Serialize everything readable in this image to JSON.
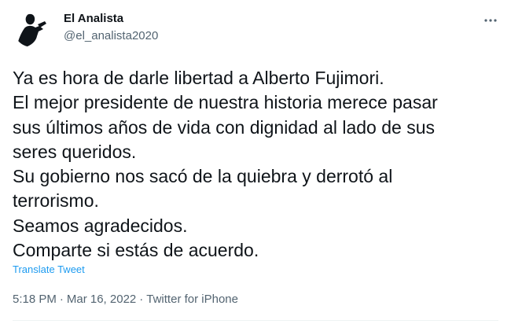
{
  "author": {
    "display_name": "El Analista",
    "handle": "@el_analista2020"
  },
  "icons": {
    "avatar": "silhouette-reading-avatar",
    "more": "more-horizontal-icon"
  },
  "tweet": {
    "lines": [
      "Ya es hora de darle libertad a Alberto Fujimori.",
      "El mejor presidente de nuestra historia merece pasar",
      "sus últimos años de vida con dignidad al lado de sus",
      "seres queridos.",
      "Su gobierno nos sacó de la quiebra y derrotó al",
      "terrorismo.",
      "Seamos agradecidos.",
      "Comparte si estás de acuerdo."
    ],
    "translate_label": "Translate Tweet"
  },
  "meta": {
    "time": "5:18 PM",
    "separator": "·",
    "date": "Mar 16, 2022",
    "source": "Twitter for iPhone"
  },
  "colors": {
    "text": "#0f1419",
    "secondary": "#536471",
    "link": "#1d9bf0",
    "divider": "#eff3f4"
  }
}
